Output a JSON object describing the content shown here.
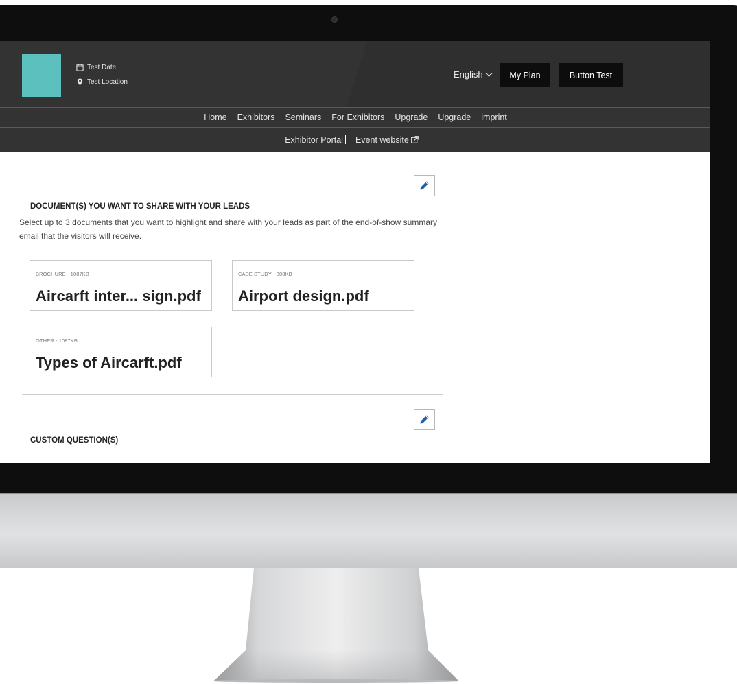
{
  "header": {
    "date": "Test Date",
    "location": "Test Location",
    "language": "English",
    "my_plan": "My Plan",
    "button_test": "Button Test"
  },
  "nav_primary": [
    "Home",
    "Exhibitors",
    "Seminars",
    "For Exhibitors",
    "Upgrade",
    "Upgrade",
    "imprint"
  ],
  "nav_secondary": {
    "exhibitor_portal": "Exhibitor Portal",
    "event_website": "Event website"
  },
  "documents_section": {
    "title": "DOCUMENT(S) YOU WANT TO SHARE WITH YOUR LEADS",
    "description": "Select up to 3 documents that you want to highlight and share with your leads as part of the end-of-show summary email that the visitors will receive.",
    "documents": [
      {
        "type": "BROCHURE - 1087KB",
        "name": "Aircarft inter... sign.pdf"
      },
      {
        "type": "CASE STUDY - 308KB",
        "name": "Airport design.pdf"
      },
      {
        "type": "OTHER - 1087KB",
        "name": "Types of Aircarft.pdf"
      }
    ]
  },
  "custom_questions_section": {
    "title": "CUSTOM QUESTION(S)"
  },
  "colors": {
    "header_bg": "#333333",
    "logo": "#5bc0be",
    "button_bg": "#0d0d0d",
    "edit_icon": "#1f5fa6"
  },
  "icons": [
    "calendar-icon",
    "location-pin-icon",
    "chevron-down-icon",
    "external-link-icon",
    "pencil-icon"
  ]
}
